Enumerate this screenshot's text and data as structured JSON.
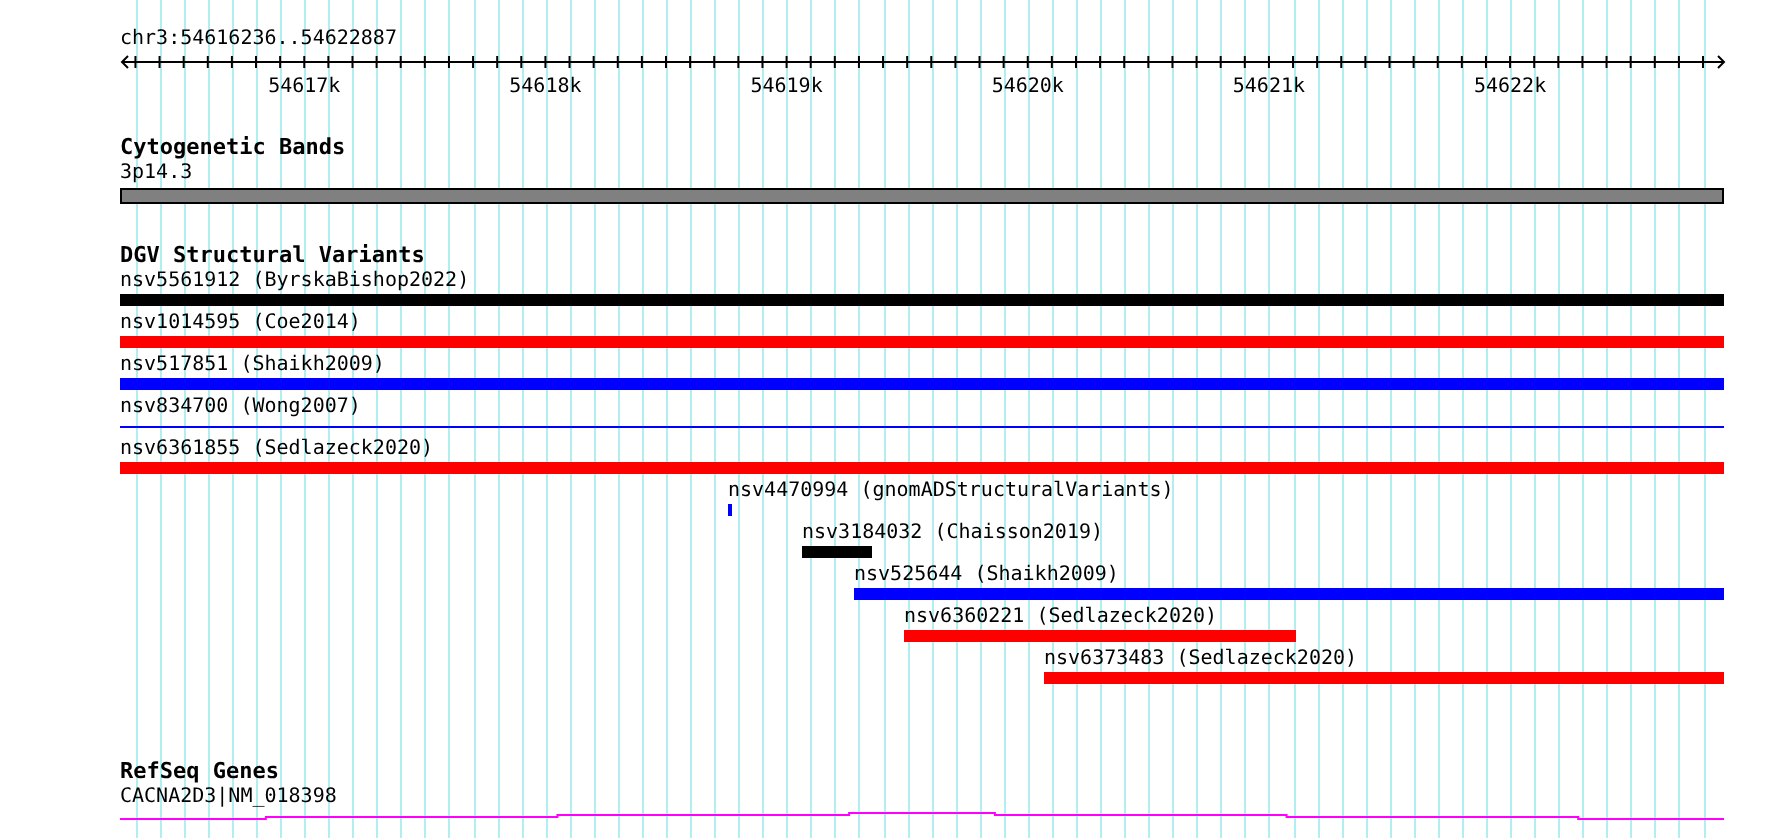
{
  "ruler": {
    "title": "chr3:54616236..54622887",
    "labels": [
      "54617k",
      "54618k",
      "54619k",
      "54620k",
      "54621k",
      "54622k"
    ]
  },
  "tracks": [
    {
      "kind": "cytoband",
      "title": "Cytogenetic Bands",
      "features": [
        {
          "label": "3p14.3",
          "color": "#808080",
          "kind": "band"
        }
      ]
    },
    {
      "kind": "variants",
      "title": "DGV Structural Variants",
      "features": [
        {
          "label": "nsv5561912 (ByrskaBishop2022)",
          "color": "#000000",
          "kind": "thick"
        },
        {
          "label": "nsv1014595 (Coe2014)",
          "color": "#ff0000",
          "kind": "thick"
        },
        {
          "label": "nsv517851 (Shaikh2009)",
          "color": "#0000ff",
          "kind": "thick"
        },
        {
          "label": "nsv834700 (Wong2007)",
          "color": "#0000ff",
          "kind": "thin"
        },
        {
          "label": "nsv6361855 (Sedlazeck2020)",
          "color": "#ff0000",
          "kind": "thick"
        },
        {
          "label": "nsv4470994 (gnomADStructuralVariants)",
          "color": "#0000ff",
          "kind": "thick"
        },
        {
          "label": "nsv3184032 (Chaisson2019)",
          "color": "#000000",
          "kind": "thick"
        },
        {
          "label": "nsv525644 (Shaikh2009)",
          "color": "#0000ff",
          "kind": "thick"
        },
        {
          "label": "nsv6360221 (Sedlazeck2020)",
          "color": "#ff0000",
          "kind": "thick"
        },
        {
          "label": "nsv6373483 (Sedlazeck2020)",
          "color": "#ff0000",
          "kind": "thick"
        }
      ]
    },
    {
      "kind": "genes",
      "title": "RefSeq Genes",
      "features": [
        {
          "label": "CACNA2D3|NM_018398",
          "color": "#ff00ff",
          "kind": "gene"
        }
      ]
    }
  ]
}
